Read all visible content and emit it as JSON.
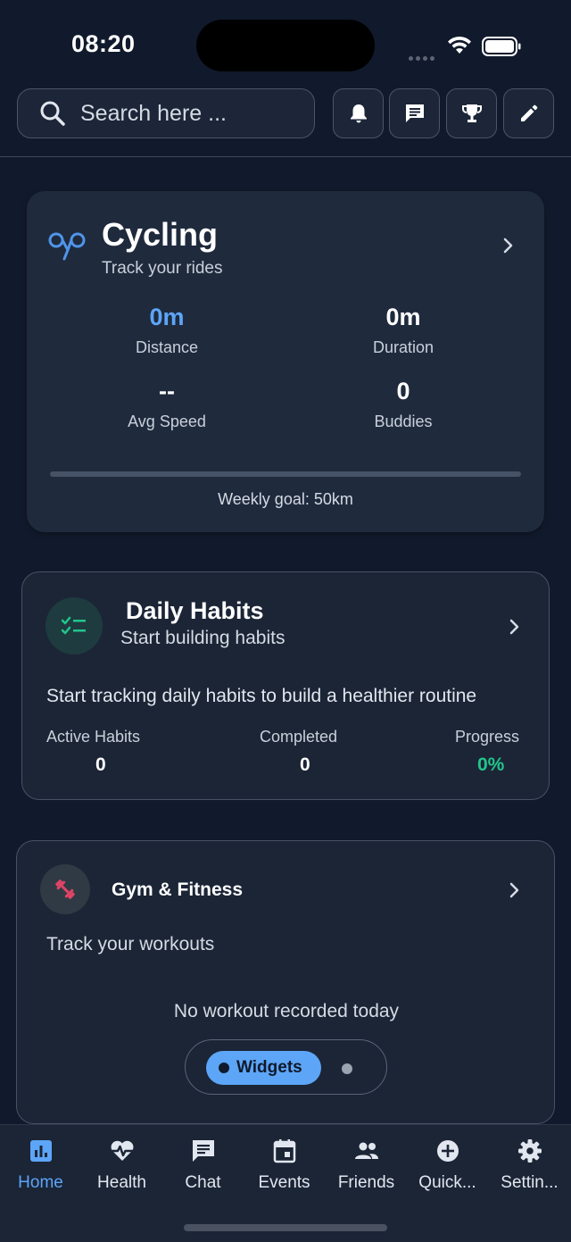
{
  "status_bar": {
    "time": "08:20"
  },
  "search": {
    "placeholder": "Search here ..."
  },
  "header_buttons": [
    "bell-icon",
    "message-icon",
    "trophy-icon",
    "edit-icon"
  ],
  "cycling": {
    "title": "Cycling",
    "subtitle": "Track your rides",
    "stats": [
      {
        "value": "0m",
        "label": "Distance"
      },
      {
        "value": "0m",
        "label": "Duration"
      },
      {
        "value": "--",
        "label": "Avg Speed"
      },
      {
        "value": "0",
        "label": "Buddies"
      }
    ],
    "weekly_goal_text": "Weekly goal: 50km",
    "weekly_progress": 0
  },
  "habits": {
    "title": "Daily Habits",
    "subtitle": "Start building habits",
    "description": "Start tracking daily habits to build a healthier routine",
    "stats": [
      {
        "label": "Active Habits",
        "value": "0"
      },
      {
        "label": "Completed",
        "value": "0"
      },
      {
        "label": "Progress",
        "value": "0%"
      }
    ]
  },
  "gym": {
    "title": "Gym & Fitness",
    "subtitle": "Track your workouts",
    "empty_text": "No workout recorded today",
    "widget_tab": "Widgets"
  },
  "nav": [
    {
      "label": "Home",
      "icon": "chart-icon",
      "active": true
    },
    {
      "label": "Health",
      "icon": "heart-pulse-icon"
    },
    {
      "label": "Chat",
      "icon": "chat-icon"
    },
    {
      "label": "Events",
      "icon": "calendar-icon"
    },
    {
      "label": "Friends",
      "icon": "people-icon"
    },
    {
      "label": "Quick...",
      "icon": "plus-circle-icon"
    },
    {
      "label": "Settin...",
      "icon": "gear-icon"
    }
  ],
  "colors": {
    "accent": "#5da5f7",
    "success": "#22c58b",
    "danger": "#e04466",
    "background": "#111a2c",
    "card": "#1f2a3d"
  }
}
